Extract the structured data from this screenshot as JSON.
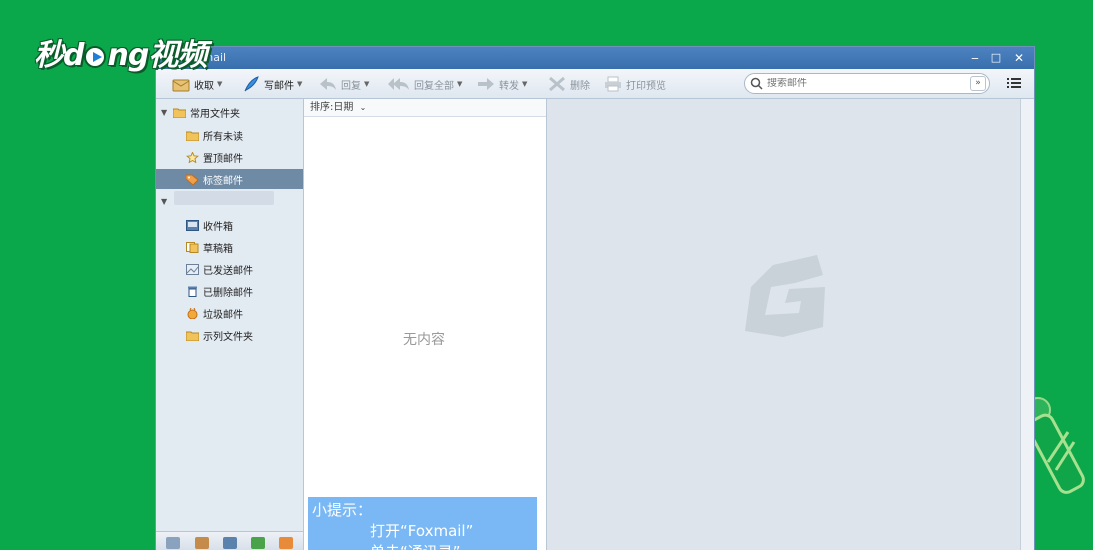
{
  "watermark": {
    "logo_text": "秒dong视频"
  },
  "window": {
    "title": "xmail",
    "controls": {
      "minimize": "‒",
      "maximize": "□",
      "close": "✕"
    }
  },
  "toolbar": {
    "receive": "收取",
    "compose": "写邮件",
    "reply": "回复",
    "reply_all": "回复全部",
    "forward": "转发",
    "delete": "删除",
    "print_preview": "打印预览"
  },
  "search": {
    "placeholder": "搜索邮件"
  },
  "sidebar": {
    "common_folder": "常用文件夹",
    "common_items": [
      {
        "label": "所有未读",
        "icon": "folder-icon"
      },
      {
        "label": "置顶邮件",
        "icon": "star-icon"
      },
      {
        "label": "标签邮件",
        "icon": "tag-icon",
        "selected": true
      }
    ],
    "account_items": [
      {
        "label": "收件箱",
        "icon": "inbox-icon"
      },
      {
        "label": "草稿箱",
        "icon": "drafts-icon"
      },
      {
        "label": "已发送邮件",
        "icon": "sent-icon"
      },
      {
        "label": "已删除邮件",
        "icon": "trash-icon"
      },
      {
        "label": "垃圾邮件",
        "icon": "spam-icon"
      },
      {
        "label": "示列文件夹",
        "icon": "folder-icon"
      }
    ]
  },
  "maillist": {
    "sort_label": "排序:日期",
    "empty_text": "无内容"
  },
  "tip": {
    "title": "小提示：",
    "line1": "打开“Foxmail”",
    "line2": "单击“通讯录”"
  },
  "colors": {
    "background": "#0aa84a",
    "titlebar": "#3a6fae",
    "selected_row": "#6f8aa5",
    "tip_box": "#79b8f4"
  }
}
